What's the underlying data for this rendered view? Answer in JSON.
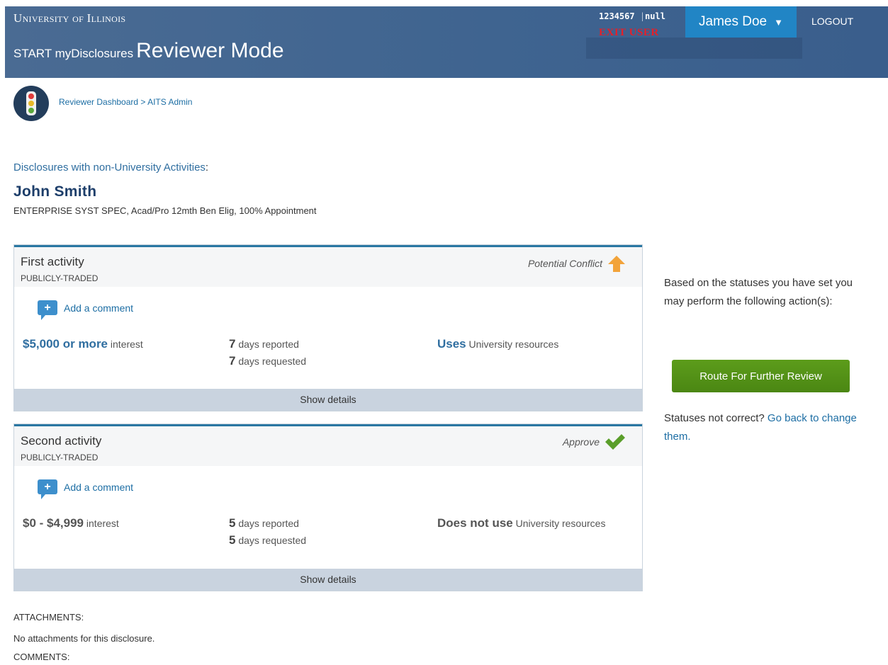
{
  "header": {
    "university": "University of Illinois",
    "app_prefix": "START myDisclosures",
    "mode": "Reviewer Mode",
    "user_id": "1234567",
    "user_sep": "|",
    "user_extra": "null",
    "exit_user": "EXIT USER",
    "user_name": "James Doe",
    "logout": "LOGOUT"
  },
  "breadcrumb": {
    "dashboard": "Reviewer Dashboard",
    "separator": ">",
    "current": "AITS Admin"
  },
  "disclosure": {
    "section_title": "Disclosures with non-University Activities",
    "name": "John Smith",
    "position": "ENTERPRISE SYST SPEC, Acad/Pro 12mth Ben Elig, 100% Appointment"
  },
  "activities": [
    {
      "name": "First activity",
      "type": "PUBLICLY-TRADED",
      "status": "Potential Conflict",
      "comment_label": "Add a comment",
      "interest_amount": "$5,000 or more",
      "interest_label": "interest",
      "days_reported": "7",
      "days_reported_label": "days reported",
      "days_requested": "7",
      "days_requested_label": "days requested",
      "resources_strong": "Uses",
      "resources_label": "University resources",
      "details_label": "Show details"
    },
    {
      "name": "Second activity",
      "type": "PUBLICLY-TRADED",
      "status": "Approve",
      "comment_label": "Add a comment",
      "interest_amount": "$0 - $4,999",
      "interest_label": "interest",
      "days_reported": "5",
      "days_reported_label": "days reported",
      "days_requested": "5",
      "days_requested_label": "days requested",
      "resources_strong": "Does not use",
      "resources_label": "University resources",
      "details_label": "Show details"
    }
  ],
  "actions": {
    "intro": "Based on the statuses you have set you may perform the following action(s):",
    "route_button": "Route For Further Review",
    "not_correct": "Statuses not correct?",
    "go_back_link": "Go back to change them."
  },
  "attachments": {
    "label": "ATTACHMENTS:",
    "empty": "No attachments for this disclosure."
  },
  "comments": {
    "label": "COMMENTS:"
  },
  "colors": {
    "header_bg": "#3f6490",
    "user_button": "#2185c5",
    "link": "#1d6ea4",
    "route_button": "#4b8713",
    "conflict_arrow": "#f2a33a",
    "approve_check": "#5a9e2a"
  }
}
